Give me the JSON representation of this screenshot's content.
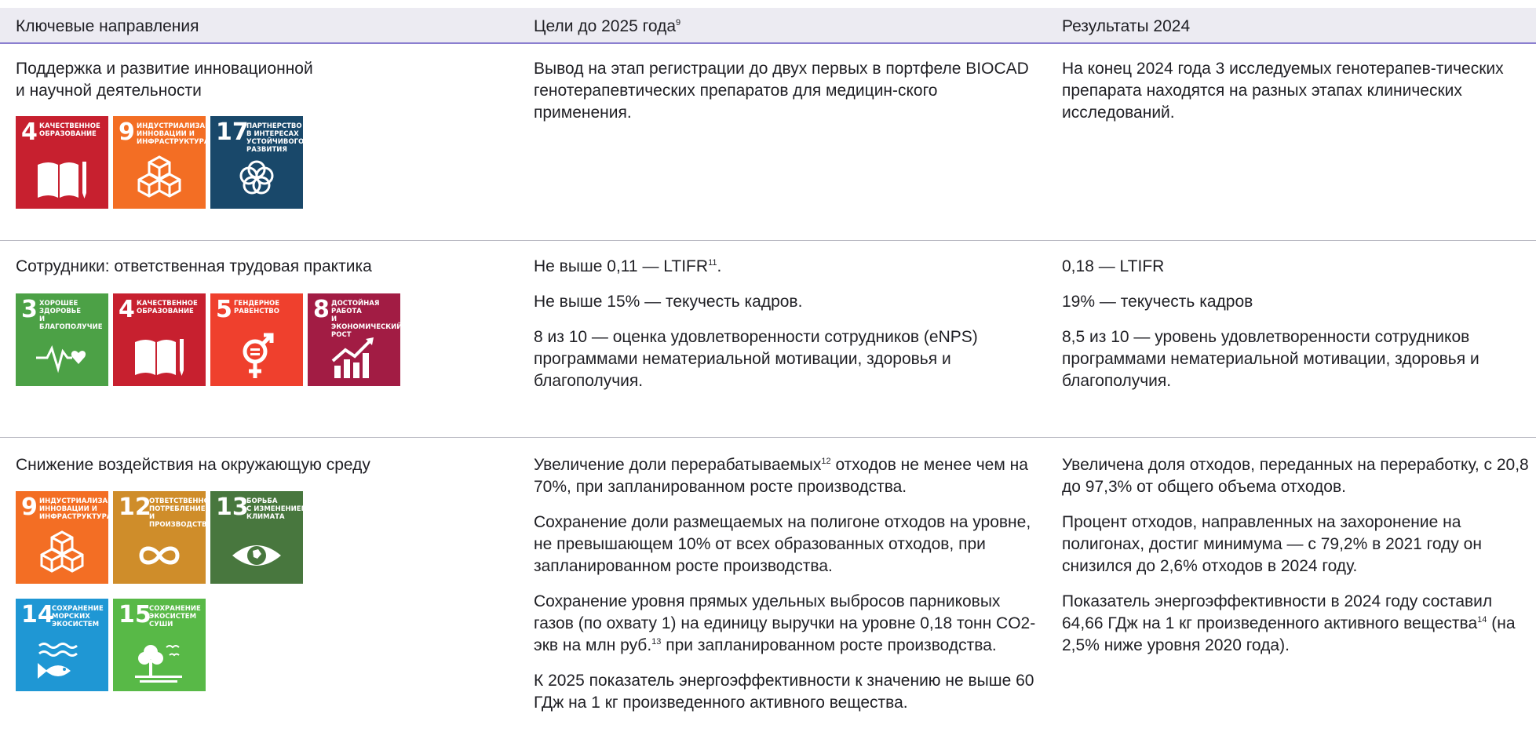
{
  "header": {
    "col1": "Ключевые направления",
    "col2": "Цели до 2025 года",
    "col2_sup": "9",
    "col3": "Результаты 2024"
  },
  "colors": {
    "header_bg": "#ecebf2",
    "header_rule": "#8b7fd0",
    "sdg3": "#4ca146",
    "sdg4": "#c7202f",
    "sdg5": "#ef402d",
    "sdg8": "#a21c44",
    "sdg9": "#f36e24",
    "sdg12": "#cf8d2a",
    "sdg13": "#48773e",
    "sdg14": "#1f97d4",
    "sdg15": "#58b947",
    "sdg17": "#19486a"
  },
  "rows": [
    {
      "title_line1": "Поддержка и развитие инновационной",
      "title_line2": "и научной деятельности",
      "sdgs": [
        {
          "number": "4",
          "label": "КАЧЕСТВЕННОЕ\nОБРАЗОВАНИЕ",
          "icon": "book-pencil-icon"
        },
        {
          "number": "9",
          "label": "ИНДУСТРИАЛИЗАЦИЯ,\nИННОВАЦИИ И\nИНФРАСТРУКТУРА",
          "icon": "cubes-icon"
        },
        {
          "number": "17",
          "label": "ПАРТНЕРСТВО\nВ ИНТЕРЕСАХ\nУСТОЙЧИВОГО РАЗВИТИЯ",
          "icon": "rings-flower-icon"
        }
      ],
      "goals": [
        {
          "text": "Вывод на этап регистрации до двух первых в портфеле BIOCAD генотерапевтических препаратов для медицин-ского применения."
        }
      ],
      "results": [
        {
          "text": "На конец 2024 года 3 исследуемых генотерапев-тических препарата находятся на разных этапах клинических исследований."
        }
      ]
    },
    {
      "title_line1": "Сотрудники: ответственная трудовая практика",
      "sdgs": [
        {
          "number": "3",
          "label": "ХОРОШЕЕ ЗДОРОВЬЕ\nИ БЛАГОПОЛУЧИЕ",
          "icon": "heartbeat-icon"
        },
        {
          "number": "4",
          "label": "КАЧЕСТВЕННОЕ\nОБРАЗОВАНИЕ",
          "icon": "book-pencil-icon"
        },
        {
          "number": "5",
          "label": "ГЕНДЕРНОЕ\nРАВЕНСТВО",
          "icon": "gender-equality-icon"
        },
        {
          "number": "8",
          "label": "ДОСТОЙНАЯ РАБОТА\nИ ЭКОНОМИЧЕСКИЙ\nРОСТ",
          "icon": "growth-chart-icon"
        }
      ],
      "goals": [
        {
          "text": "Не выше 0,11 — LTIFR",
          "sup": "11",
          "after": "."
        },
        {
          "text": "Не выше 15% — текучесть кадров."
        },
        {
          "text": "8 из 10 — оценка удовлетворенности сотрудников (eNPS) программами нематериальной мотивации, здоровья и благополучия."
        }
      ],
      "results": [
        {
          "text": "0,18 — LTIFR"
        },
        {
          "text": "19% — текучесть кадров"
        },
        {
          "text": "8,5 из 10 — уровень удовлетворенности сотрудников программами нематериальной мотивации, здоровья и благополучия."
        }
      ]
    },
    {
      "title_line1": "Снижение воздействия на окружающую среду",
      "sdgs": [
        {
          "number": "9",
          "label": "ИНДУСТРИАЛИЗАЦИЯ,\nИННОВАЦИИ И\nИНФРАСТРУКТУРА",
          "icon": "cubes-icon"
        },
        {
          "number": "12",
          "label": "ОТВЕТСТВЕННОЕ\nПОТРЕБЛЕНИЕ\nИ ПРОИЗВОДСТВО",
          "icon": "infinity-icon"
        },
        {
          "number": "13",
          "label": "БОРЬБА\nС ИЗМЕНЕНИЕМ\nКЛИМАТА",
          "icon": "earth-eye-icon"
        },
        {
          "number": "14",
          "label": "СОХРАНЕНИЕ\nМОРСКИХ\nЭКОСИСТЕМ",
          "icon": "fish-waves-icon"
        },
        {
          "number": "15",
          "label": "СОХРАНЕНИЕ\nЭКОСИСТЕМ СУШИ",
          "icon": "tree-birds-icon"
        }
      ],
      "goals": [
        {
          "text": "Увеличение доли перерабатываемых",
          "sup": "12",
          "after": " отходов не менее чем на 70%, при запланированном росте производства."
        },
        {
          "text": "Сохранение доли размещаемых на полигоне отходов на уровне, не превышающем 10% от всех образованных отходов, при запланированном росте производства."
        },
        {
          "text": "Сохранение уровня прямых удельных выбросов парниковых газов (по охвату 1) на единицу выручки на уровне 0,18 тонн CO2-экв на млн руб.",
          "sup": "13",
          "after": " при запланированном росте производства."
        },
        {
          "text": "К 2025 показатель энергоэффективности к значению не выше 60 ГДж на 1 кг произведенного активного вещества."
        }
      ],
      "results": [
        {
          "text": "Увеличена доля отходов, переданных на переработку, с 20,8 до 97,3% от общего объема отходов."
        },
        {
          "text": "Процент отходов, направленных на захоронение на полигонах, достиг минимума — с 79,2% в 2021 году он снизился до 2,6% отходов в 2024 году."
        },
        {
          "text": "Показатель энергоэффективности в 2024 году составил 64,66 ГДж на 1 кг произведенного активного вещества",
          "sup": "14",
          "after": " (на 2,5% ниже уровня 2020 года)."
        }
      ]
    }
  ]
}
